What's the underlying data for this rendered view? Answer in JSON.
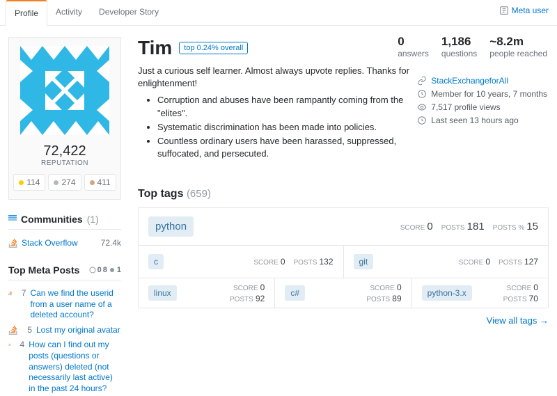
{
  "tabs": {
    "profile": "Profile",
    "activity": "Activity",
    "devstory": "Developer Story"
  },
  "meta_user_link": "Meta user",
  "user": {
    "name": "Tim",
    "rank_badge": "top 0.24% overall",
    "bio_intro": "Just a curious self learner. Almost always upvote replies. Thanks for enlightenment!",
    "bio_points": [
      "Corruption and abuses have been rampantly coming from the \"elites\".",
      "Systematic discrimination has been made into policies.",
      "Countless ordinary users have been harassed, suppressed, suffocated, and persecuted."
    ],
    "reputation": "72,422",
    "reputation_label": "REPUTATION",
    "badges": {
      "gold": "114",
      "silver": "274",
      "bronze": "411"
    }
  },
  "stats": {
    "answers": {
      "value": "0",
      "label": "answers"
    },
    "questions": {
      "value": "1,186",
      "label": "questions"
    },
    "reached": {
      "value": "~8.2m",
      "label": "people reached"
    }
  },
  "meta": {
    "site": "StackExchangeforAll",
    "member": "Member for 10 years, 7 months",
    "views": "7,517 profile views",
    "seen": "Last seen 13 hours ago"
  },
  "communities": {
    "heading": "Communities",
    "count": "(1)",
    "items": [
      {
        "name": "Stack Overflow",
        "rep": "72.4k"
      }
    ]
  },
  "meta_posts": {
    "heading": "Top Meta Posts",
    "counts": {
      "a": "0",
      "b": "8",
      "c": "1"
    },
    "items": [
      {
        "score": "7",
        "title": "Can we find the userid from a user name of a deleted account?"
      },
      {
        "score": "5",
        "title": "Lost my original avatar"
      },
      {
        "score": "4",
        "title": "How can I find out my posts (questions or answers) deleted (not necessarily last active) in the past 24 hours?"
      }
    ]
  },
  "top_tags": {
    "heading": "Top tags",
    "count": "(659)",
    "labels": {
      "score": "SCORE",
      "posts": "POSTS",
      "pct": "POSTS %"
    },
    "primary": {
      "name": "python",
      "score": "0",
      "posts": "181",
      "pct": "15"
    },
    "row2": [
      {
        "name": "c",
        "score": "0",
        "posts": "132"
      },
      {
        "name": "git",
        "score": "0",
        "posts": "127"
      }
    ],
    "row3": [
      {
        "name": "linux",
        "score": "0",
        "posts": "92"
      },
      {
        "name": "c#",
        "score": "0",
        "posts": "89"
      },
      {
        "name": "python-3.x",
        "score": "0",
        "posts": "70"
      }
    ],
    "view_all": "View all tags →"
  }
}
